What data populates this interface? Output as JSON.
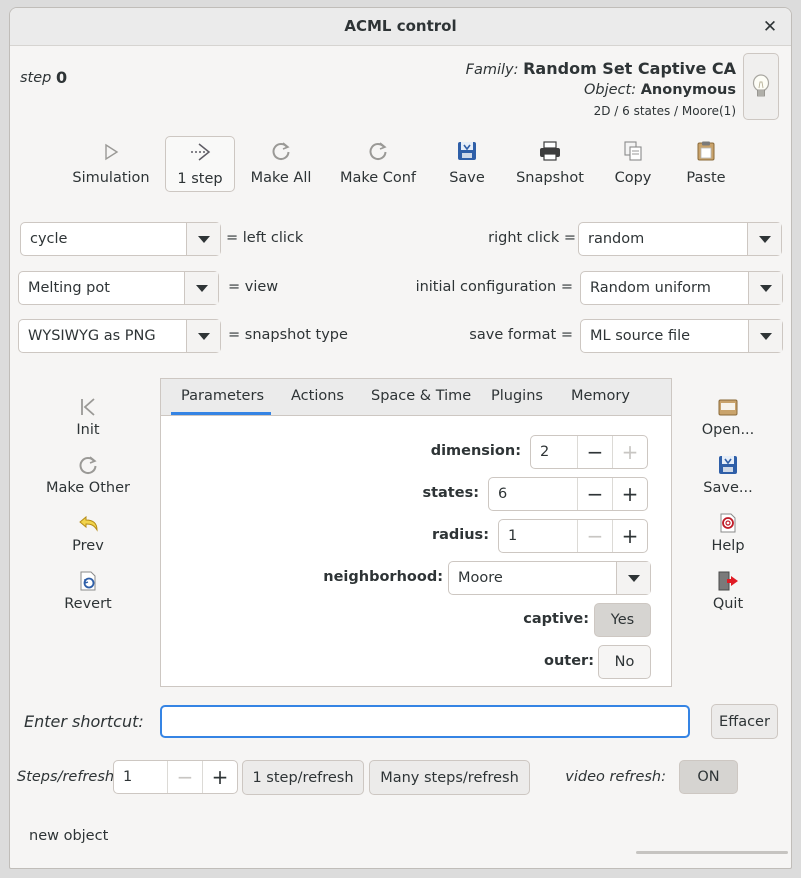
{
  "window": {
    "title": "ACML control"
  },
  "header": {
    "step_label": "step",
    "step_value": "0",
    "family_label": "Family:",
    "family_value": "Random Set Captive CA",
    "object_label": "Object:",
    "object_value": "Anonymous",
    "info": "2D / 6 states / Moore(1)"
  },
  "toolbar": {
    "items": [
      {
        "label": "Simulation",
        "icon": "play-icon"
      },
      {
        "label": "1 step",
        "icon": "step-icon"
      },
      {
        "label": "Make All",
        "icon": "refresh-icon"
      },
      {
        "label": "Make Conf",
        "icon": "refresh-icon"
      },
      {
        "label": "Save",
        "icon": "save-icon"
      },
      {
        "label": "Snapshot",
        "icon": "printer-icon"
      },
      {
        "label": "Copy",
        "icon": "copy-icon"
      },
      {
        "label": "Paste",
        "icon": "paste-icon"
      }
    ]
  },
  "combos": {
    "left_click": {
      "value": "cycle",
      "label": "= left click"
    },
    "right_click": {
      "label": "right click =",
      "value": "random"
    },
    "view": {
      "value": "Melting pot",
      "label": "= view"
    },
    "initial_config": {
      "label": "initial configuration =",
      "value": "Random uniform"
    },
    "snapshot_type": {
      "value": "WYSIWYG as PNG",
      "label": "= snapshot type"
    },
    "save_format": {
      "label": "save format =",
      "value": "ML source file"
    }
  },
  "left_side": {
    "items": [
      {
        "label": "Init",
        "icon": "rewind-icon"
      },
      {
        "label": "Make Other",
        "icon": "refresh-icon"
      },
      {
        "label": "Prev",
        "icon": "undo-icon"
      },
      {
        "label": "Revert",
        "icon": "revert-icon"
      }
    ]
  },
  "right_side": {
    "items": [
      {
        "label": "Open...",
        "icon": "folder-icon"
      },
      {
        "label": "Save...",
        "icon": "save-icon"
      },
      {
        "label": "Help",
        "icon": "help-icon"
      },
      {
        "label": "Quit",
        "icon": "exit-icon"
      }
    ]
  },
  "tabs": [
    "Parameters",
    "Actions",
    "Space & Time",
    "Plugins",
    "Memory"
  ],
  "parameters": {
    "dimension": {
      "label": "dimension:",
      "value": "2"
    },
    "states": {
      "label": "states:",
      "value": "6"
    },
    "radius": {
      "label": "radius:",
      "value": "1"
    },
    "neighborhood": {
      "label": "neighborhood:",
      "value": "Moore"
    },
    "captive": {
      "label": "captive:",
      "value": "Yes"
    },
    "outer": {
      "label": "outer:",
      "value": "No"
    }
  },
  "shortcut": {
    "label": "Enter shortcut:",
    "value": "",
    "clear_button": "Effacer"
  },
  "steps": {
    "label": "Steps/refresh:",
    "value": "1",
    "one_step_button": "1 step/refresh",
    "many_steps_button": "Many steps/refresh",
    "video_label": "video refresh:",
    "video_value": "ON"
  },
  "status": {
    "text": "new object"
  },
  "colors": {
    "accent": "#3584e4",
    "background": "#f6f5f4"
  }
}
